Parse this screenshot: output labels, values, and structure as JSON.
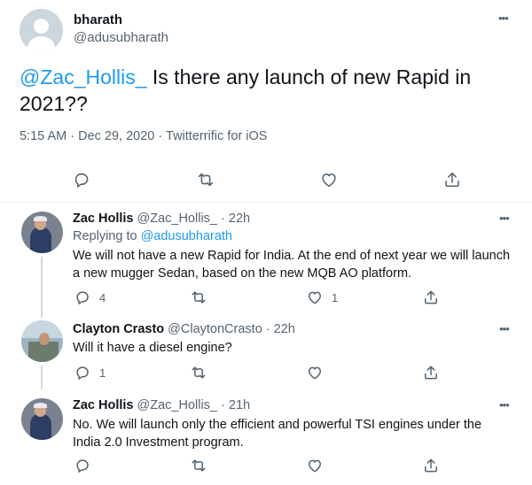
{
  "main_tweet": {
    "author_name": "bharath",
    "author_handle": "@adusubharath",
    "mention": "@Zac_Hollis_",
    "text_line1_rest": " Is there any launch of new Rapid in",
    "text_line2": "2021??",
    "time": "5:15 AM",
    "dot1": "·",
    "date": "Dec 29, 2020",
    "dot2": "·",
    "client": "Twitterrific for iOS",
    "more_glyph": "•••"
  },
  "replies": [
    {
      "name": "Zac Hollis",
      "handle": "@Zac_Hollis_",
      "dot": "·",
      "time": "22h",
      "replying_prefix": "Replying to",
      "replying_to": "@adusubharath",
      "text_line1": "We will not have a new Rapid for India. At the end of next year we will launch",
      "text_line2": "a new mugger Sedan, based on the new MQB AO platform.",
      "reply_count": "4",
      "retweet_count": "",
      "like_count": "1",
      "more_glyph": "•••"
    },
    {
      "name": "Clayton Crasto",
      "handle": "@ClaytonCrasto",
      "dot": "·",
      "time": "22h",
      "text_line1": "Will it have a diesel engine?",
      "reply_count": "1",
      "retweet_count": "",
      "like_count": "",
      "more_glyph": "•••"
    },
    {
      "name": "Zac Hollis",
      "handle": "@Zac_Hollis_",
      "dot": "·",
      "time": "21h",
      "text_line1": "No. We will launch only the efficient and powerful TSI engines under the",
      "text_line2": "India 2.0 Investment program.",
      "reply_count": "",
      "retweet_count": "",
      "like_count": "",
      "more_glyph": "•••"
    }
  ],
  "icons": {
    "reply": "reply-icon",
    "retweet": "retweet-icon",
    "like": "heart-icon",
    "share": "share-icon",
    "more": "more-icon"
  },
  "colors": {
    "link": "#1d9bf0",
    "muted": "#536471",
    "text": "#0f1419",
    "thread_line": "#cfd9de"
  }
}
